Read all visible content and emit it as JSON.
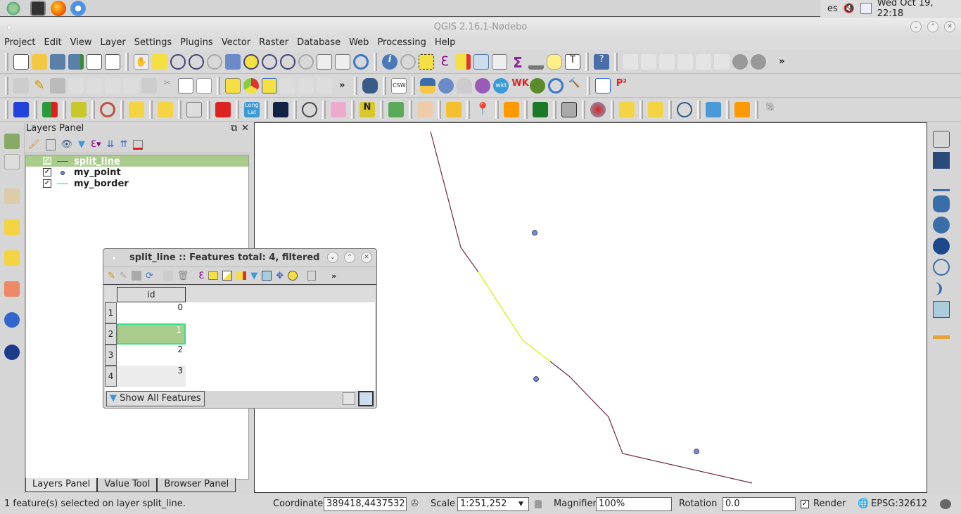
{
  "taskbar": {
    "launchers": [
      "qgis-launcher-icon",
      "terminal-icon",
      "firefox-icon",
      "chromium-icon"
    ],
    "keyboard_layout": "es",
    "clock": "Wed Oct 19, 22:18"
  },
  "window": {
    "title": "QGIS 2.16.1-Nødebo"
  },
  "menu": [
    "Project",
    "Edit",
    "View",
    "Layer",
    "Settings",
    "Plugins",
    "Vector",
    "Raster",
    "Database",
    "Web",
    "Processing",
    "Help"
  ],
  "toolbar2_labels": {
    "csw": "CSW",
    "wkt": "wkt",
    "p2": "P²",
    "more": "»"
  },
  "toolbar3_labels": {
    "longlat": "Long Lat"
  },
  "layers_panel": {
    "title": "Layers Panel",
    "layers": [
      {
        "name": "split_line",
        "checked": true,
        "selected": true,
        "symbol": "line",
        "color": "#7a3a5a"
      },
      {
        "name": "my_point",
        "checked": true,
        "selected": false,
        "symbol": "point",
        "color": "#6b8fdc"
      },
      {
        "name": "my_border",
        "checked": true,
        "selected": false,
        "symbol": "line",
        "color": "#33dd33"
      }
    ]
  },
  "dock_tabs": [
    "Layers Panel",
    "Value Tool",
    "Browser Panel"
  ],
  "attr_table": {
    "title": "split_line :: Features total: 4, filtered",
    "column": "id",
    "rows": [
      {
        "num": "1",
        "id": "0"
      },
      {
        "num": "2",
        "id": "1",
        "selected": true
      },
      {
        "num": "3",
        "id": "2"
      },
      {
        "num": "4",
        "id": "3"
      }
    ],
    "filter_button": "Show All Features",
    "more": "»"
  },
  "status": {
    "message": "1 feature(s) selected on layer split_line.",
    "coordinate_label": "Coordinate",
    "coordinate": "389418,4437532",
    "scale_label": "Scale",
    "scale": "1:251,252",
    "magnifier_label": "Magnifier",
    "magnifier": "100%",
    "rotation_label": "Rotation",
    "rotation": "0.0",
    "render_label": "Render",
    "render_checked": true,
    "crs": "EPSG:32612"
  },
  "map": {
    "line_color": "#6a2a4a",
    "selected_color": "#d4f000",
    "point_color": "#6b8fdc"
  }
}
